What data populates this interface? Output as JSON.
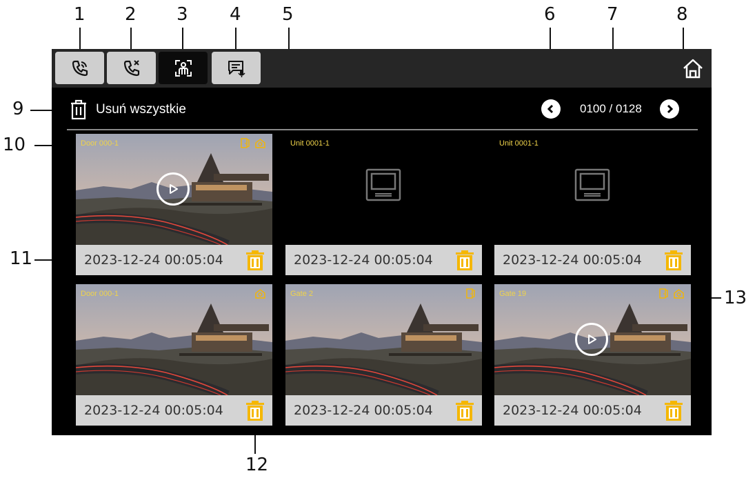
{
  "callouts": [
    "1",
    "2",
    "3",
    "4",
    "5",
    "6",
    "7",
    "8",
    "9",
    "10",
    "11",
    "12",
    "13"
  ],
  "tabs": [
    {
      "icon": "call-log-icon",
      "active": false
    },
    {
      "icon": "missed-call-icon",
      "active": false
    },
    {
      "icon": "visitor-snapshot-icon",
      "active": true
    },
    {
      "icon": "voice-message-icon",
      "active": false
    }
  ],
  "toolbar": {
    "delete_all_label": "Usuń wszystkie",
    "page_indicator": "0100 / 0128"
  },
  "cards": [
    {
      "caption": "Door 000-1",
      "timestamp": "2023-12-24  00:05:04",
      "kind": "video",
      "door_icon": true,
      "cam_icon": true
    },
    {
      "caption": "Unit 0001-1",
      "timestamp": "2023-12-24  00:05:04",
      "kind": "monitor",
      "door_icon": false,
      "cam_icon": false
    },
    {
      "caption": "Unit 0001-1",
      "timestamp": "2023-12-24  00:05:04",
      "kind": "monitor",
      "door_icon": false,
      "cam_icon": false
    },
    {
      "caption": "Door 000-1",
      "timestamp": "2023-12-24  00:05:04",
      "kind": "photo",
      "door_icon": false,
      "cam_icon": true
    },
    {
      "caption": "Gate 2",
      "timestamp": "2023-12-24  00:05:04",
      "kind": "photo",
      "door_icon": true,
      "cam_icon": false
    },
    {
      "caption": "Gate 19",
      "timestamp": "2023-12-24  00:05:04",
      "kind": "video",
      "door_icon": true,
      "cam_icon": true
    }
  ],
  "colors": {
    "accent_yellow": "#f5b700",
    "caption_yellow": "#f0d34a",
    "screen_bg": "#000000",
    "topbar_bg": "#262626"
  }
}
